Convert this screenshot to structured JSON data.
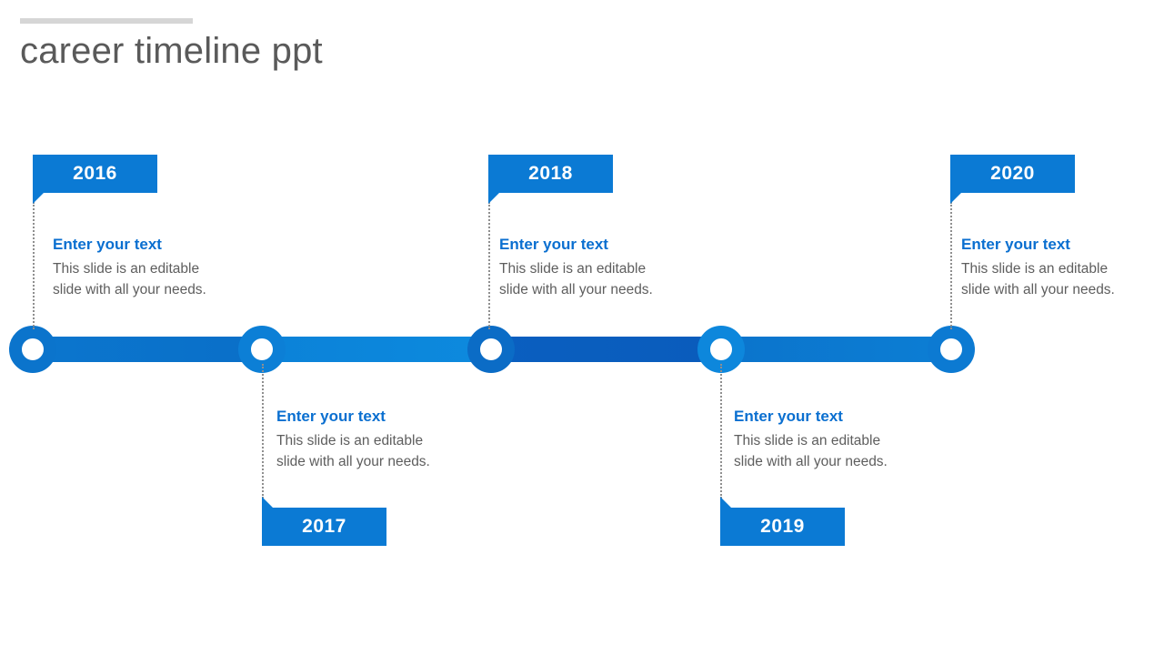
{
  "slide": {
    "title": "career timeline ppt",
    "background_color": "#ffffff",
    "accent_color": "#0b7ad4",
    "heading_color": "#0a6fd0",
    "body_text_color": "#5e5e5e",
    "title_color": "#5a5a5a",
    "rule_color": "#d6d6d6"
  },
  "timeline": {
    "milestones": [
      {
        "year": "2016",
        "position": "above",
        "heading": "Enter your  text",
        "body_line1": "This slide is an editable",
        "body_line2": "slide with  all your needs."
      },
      {
        "year": "2017",
        "position": "below",
        "heading": "Enter your  text",
        "body_line1": "This slide is an editable",
        "body_line2": "slide with  all your needs."
      },
      {
        "year": "2018",
        "position": "above",
        "heading": "Enter your  text",
        "body_line1": "This slide is an editable",
        "body_line2": "slide with  all your needs."
      },
      {
        "year": "2019",
        "position": "below",
        "heading": "Enter your  text",
        "body_line1": "This slide is an editable",
        "body_line2": "slide with  all your needs."
      },
      {
        "year": "2020",
        "position": "above",
        "heading": "Enter your  text",
        "body_line1": "This slide is an editable",
        "body_line2": "slide with  all your needs."
      }
    ]
  }
}
